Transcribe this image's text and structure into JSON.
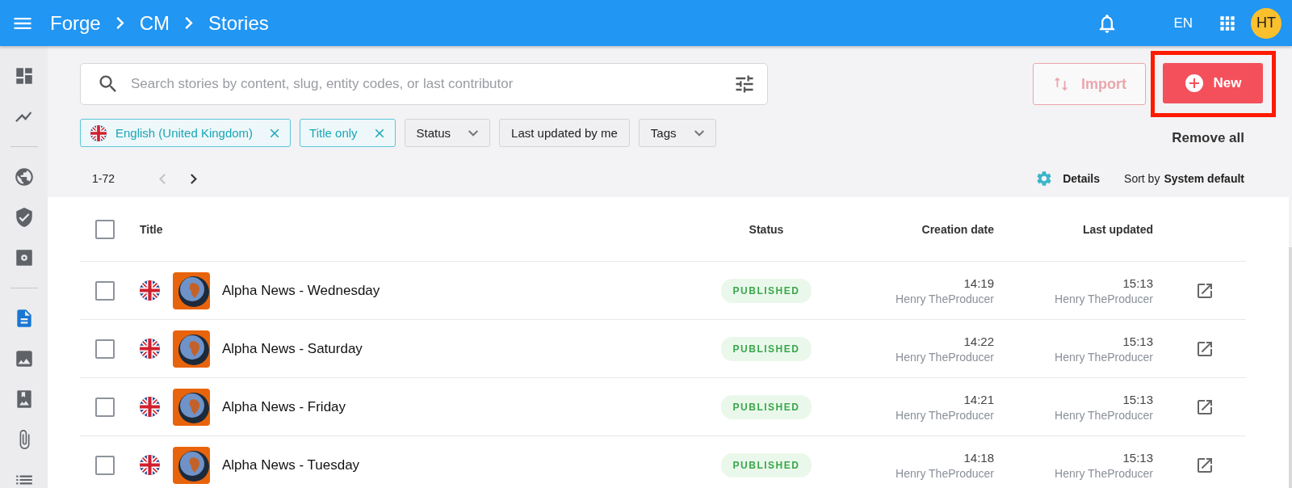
{
  "top_bar": {
    "breadcrumbs": [
      "Forge",
      "CM",
      "Stories"
    ],
    "language": "EN",
    "avatar_initials": "HT"
  },
  "sidebar": {
    "groups": [
      {
        "items": [
          {
            "selected": false
          },
          {
            "selected": false
          }
        ]
      },
      {
        "items": [
          {
            "selected": false
          },
          {
            "selected": false
          },
          {
            "selected": false
          }
        ]
      },
      {
        "items": [
          {
            "selected": true
          },
          {
            "selected": false
          },
          {
            "selected": false
          },
          {
            "selected": false
          },
          {
            "selected": false
          }
        ]
      }
    ]
  },
  "search": {
    "placeholder": "Search stories by content, slug, entity codes, or last contributor"
  },
  "import_button": {
    "label": "Import",
    "disabled": true
  },
  "new_button": {
    "label": "New",
    "highlighted": true
  },
  "filters": [
    {
      "label": "English (United Kingdom)",
      "kind": "active",
      "flag": true
    },
    {
      "label": "Title only",
      "kind": "active",
      "flag": false
    },
    {
      "label": "Status",
      "kind": "dropdown",
      "flag": false
    },
    {
      "label": "Last updated by me",
      "kind": "toggle",
      "flag": false
    },
    {
      "label": "Tags",
      "kind": "dropdown",
      "flag": false
    }
  ],
  "remove_all": "Remove all",
  "pagination": {
    "range": "1-72",
    "prev_enabled": false,
    "next_enabled": true
  },
  "details": "Details",
  "sort": {
    "label": "Sort by",
    "value": "System default"
  },
  "table": {
    "select_all_checked": false,
    "columns": [
      "Title",
      "Status",
      "Creation date",
      "Last updated"
    ],
    "rows": [
      {
        "checked": false,
        "title": "Alpha News - Wednesday",
        "status": "PUBLISHED",
        "created_time": "14:19",
        "created_by": "Henry TheProducer",
        "updated_time": "15:13",
        "updated_by": "Henry TheProducer"
      },
      {
        "checked": false,
        "title": "Alpha News - Saturday",
        "status": "PUBLISHED",
        "created_time": "14:22",
        "created_by": "Henry TheProducer",
        "updated_time": "15:13",
        "updated_by": "Henry TheProducer"
      },
      {
        "checked": false,
        "title": "Alpha News - Friday",
        "status": "PUBLISHED",
        "created_time": "14:21",
        "created_by": "Henry TheProducer",
        "updated_time": "15:13",
        "updated_by": "Henry TheProducer"
      },
      {
        "checked": false,
        "title": "Alpha News - Tuesday",
        "status": "PUBLISHED",
        "created_time": "14:18",
        "created_by": "Henry TheProducer",
        "updated_time": "15:13",
        "updated_by": "Henry TheProducer"
      }
    ]
  }
}
